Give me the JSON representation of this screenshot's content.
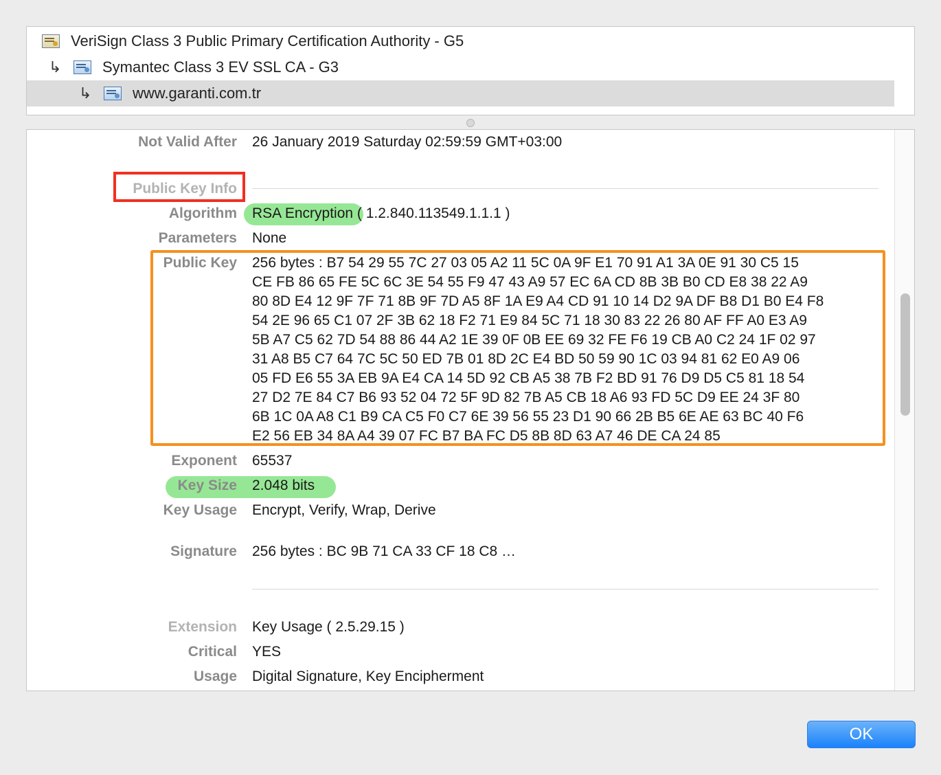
{
  "chain": {
    "items": [
      {
        "label": "VeriSign Class 3 Public Primary Certification Authority - G5",
        "icon": "certificate-icon"
      },
      {
        "label": "Symantec Class 3 EV SSL CA - G3",
        "icon": "certificate-icon",
        "prefix": "↳"
      },
      {
        "label": "www.garanti.com.tr",
        "icon": "certificate-icon",
        "prefix": "↳",
        "selected": true
      }
    ]
  },
  "details": {
    "not_valid_after": {
      "label": "Not Valid After",
      "value": "26 January 2019 Saturday 02:59:59 GMT+03:00"
    },
    "public_key_info": {
      "heading": "Public Key Info"
    },
    "algorithm": {
      "label": "Algorithm",
      "value_highlight": "RSA Encryption",
      "value_rest": " ( 1.2.840.113549.1.1.1 )"
    },
    "parameters": {
      "label": "Parameters",
      "value": "None"
    },
    "public_key": {
      "label": "Public Key",
      "lines": [
        "256 bytes : B7 54 29 55 7C 27 03 05 A2 11 5C 0A 9F E1 70 91 A1 3A 0E 91 30 C5 15",
        "CE FB 86 65 FE 5C 6C 3E 54 55 F9 47 43 A9 57 EC 6A CD 8B 3B B0 CD E8 38 22 A9",
        "80 8D E4 12 9F 7F 71 8B 9F 7D A5 8F 1A E9 A4 CD 91 10 14 D2 9A DF B8 D1 B0 E4 F8",
        "54 2E 96 65 C1 07 2F 3B 62 18 F2 71 E9 84 5C 71 18 30 83 22 26 80 AF FF A0 E3 A9",
        "5B A7 C5 62 7D 54 88 86 44 A2 1E 39 0F 0B EE 69 32 FE F6 19 CB A0 C2 24 1F 02 97",
        "31 A8 B5 C7 64 7C 5C 50 ED 7B 01 8D 2C E4 BD 50 59 90 1C 03 94 81 62 E0 A9 06",
        "05 FD E6 55 3A EB 9A E4 CA 14 5D 92 CB A5 38 7B F2 BD 91 76 D9 D5 C5 81 18 54",
        "27 D2 7E 84 C7 B6 93 52 04 72 5F 9D 82 7B A5 CB 18 A6 93 FD 5C D9 EE 24 3F 80",
        "6B 1C 0A A8 C1 B9 CA C5 F0 C7 6E 39 56 55 23 D1 90 66 2B B5 6E AE 63 BC 40 F6",
        "E2 56 EB 34 8A A4 39 07 FC B7 BA FC D5 8B 8D 63 A7 46 DE CA 24 85"
      ]
    },
    "exponent": {
      "label": "Exponent",
      "value": "65537"
    },
    "key_size": {
      "label": "Key Size",
      "value": "2.048 bits"
    },
    "key_usage": {
      "label": "Key Usage",
      "value": "Encrypt, Verify, Wrap, Derive"
    },
    "signature": {
      "label": "Signature",
      "value": "256 bytes : BC 9B 71 CA 33 CF 18 C8 …"
    },
    "extension": {
      "label": "Extension",
      "value": "Key Usage ( 2.5.29.15 )"
    },
    "critical": {
      "label": "Critical",
      "value": "YES"
    },
    "usage": {
      "label": "Usage",
      "value": "Digital Signature, Key Encipherment"
    }
  },
  "buttons": {
    "ok": "OK"
  },
  "colors": {
    "highlight_green": "#8be48a",
    "annotation_red": "#f03020",
    "annotation_orange": "#f5901e",
    "ok_blue": "#1a82fb"
  }
}
